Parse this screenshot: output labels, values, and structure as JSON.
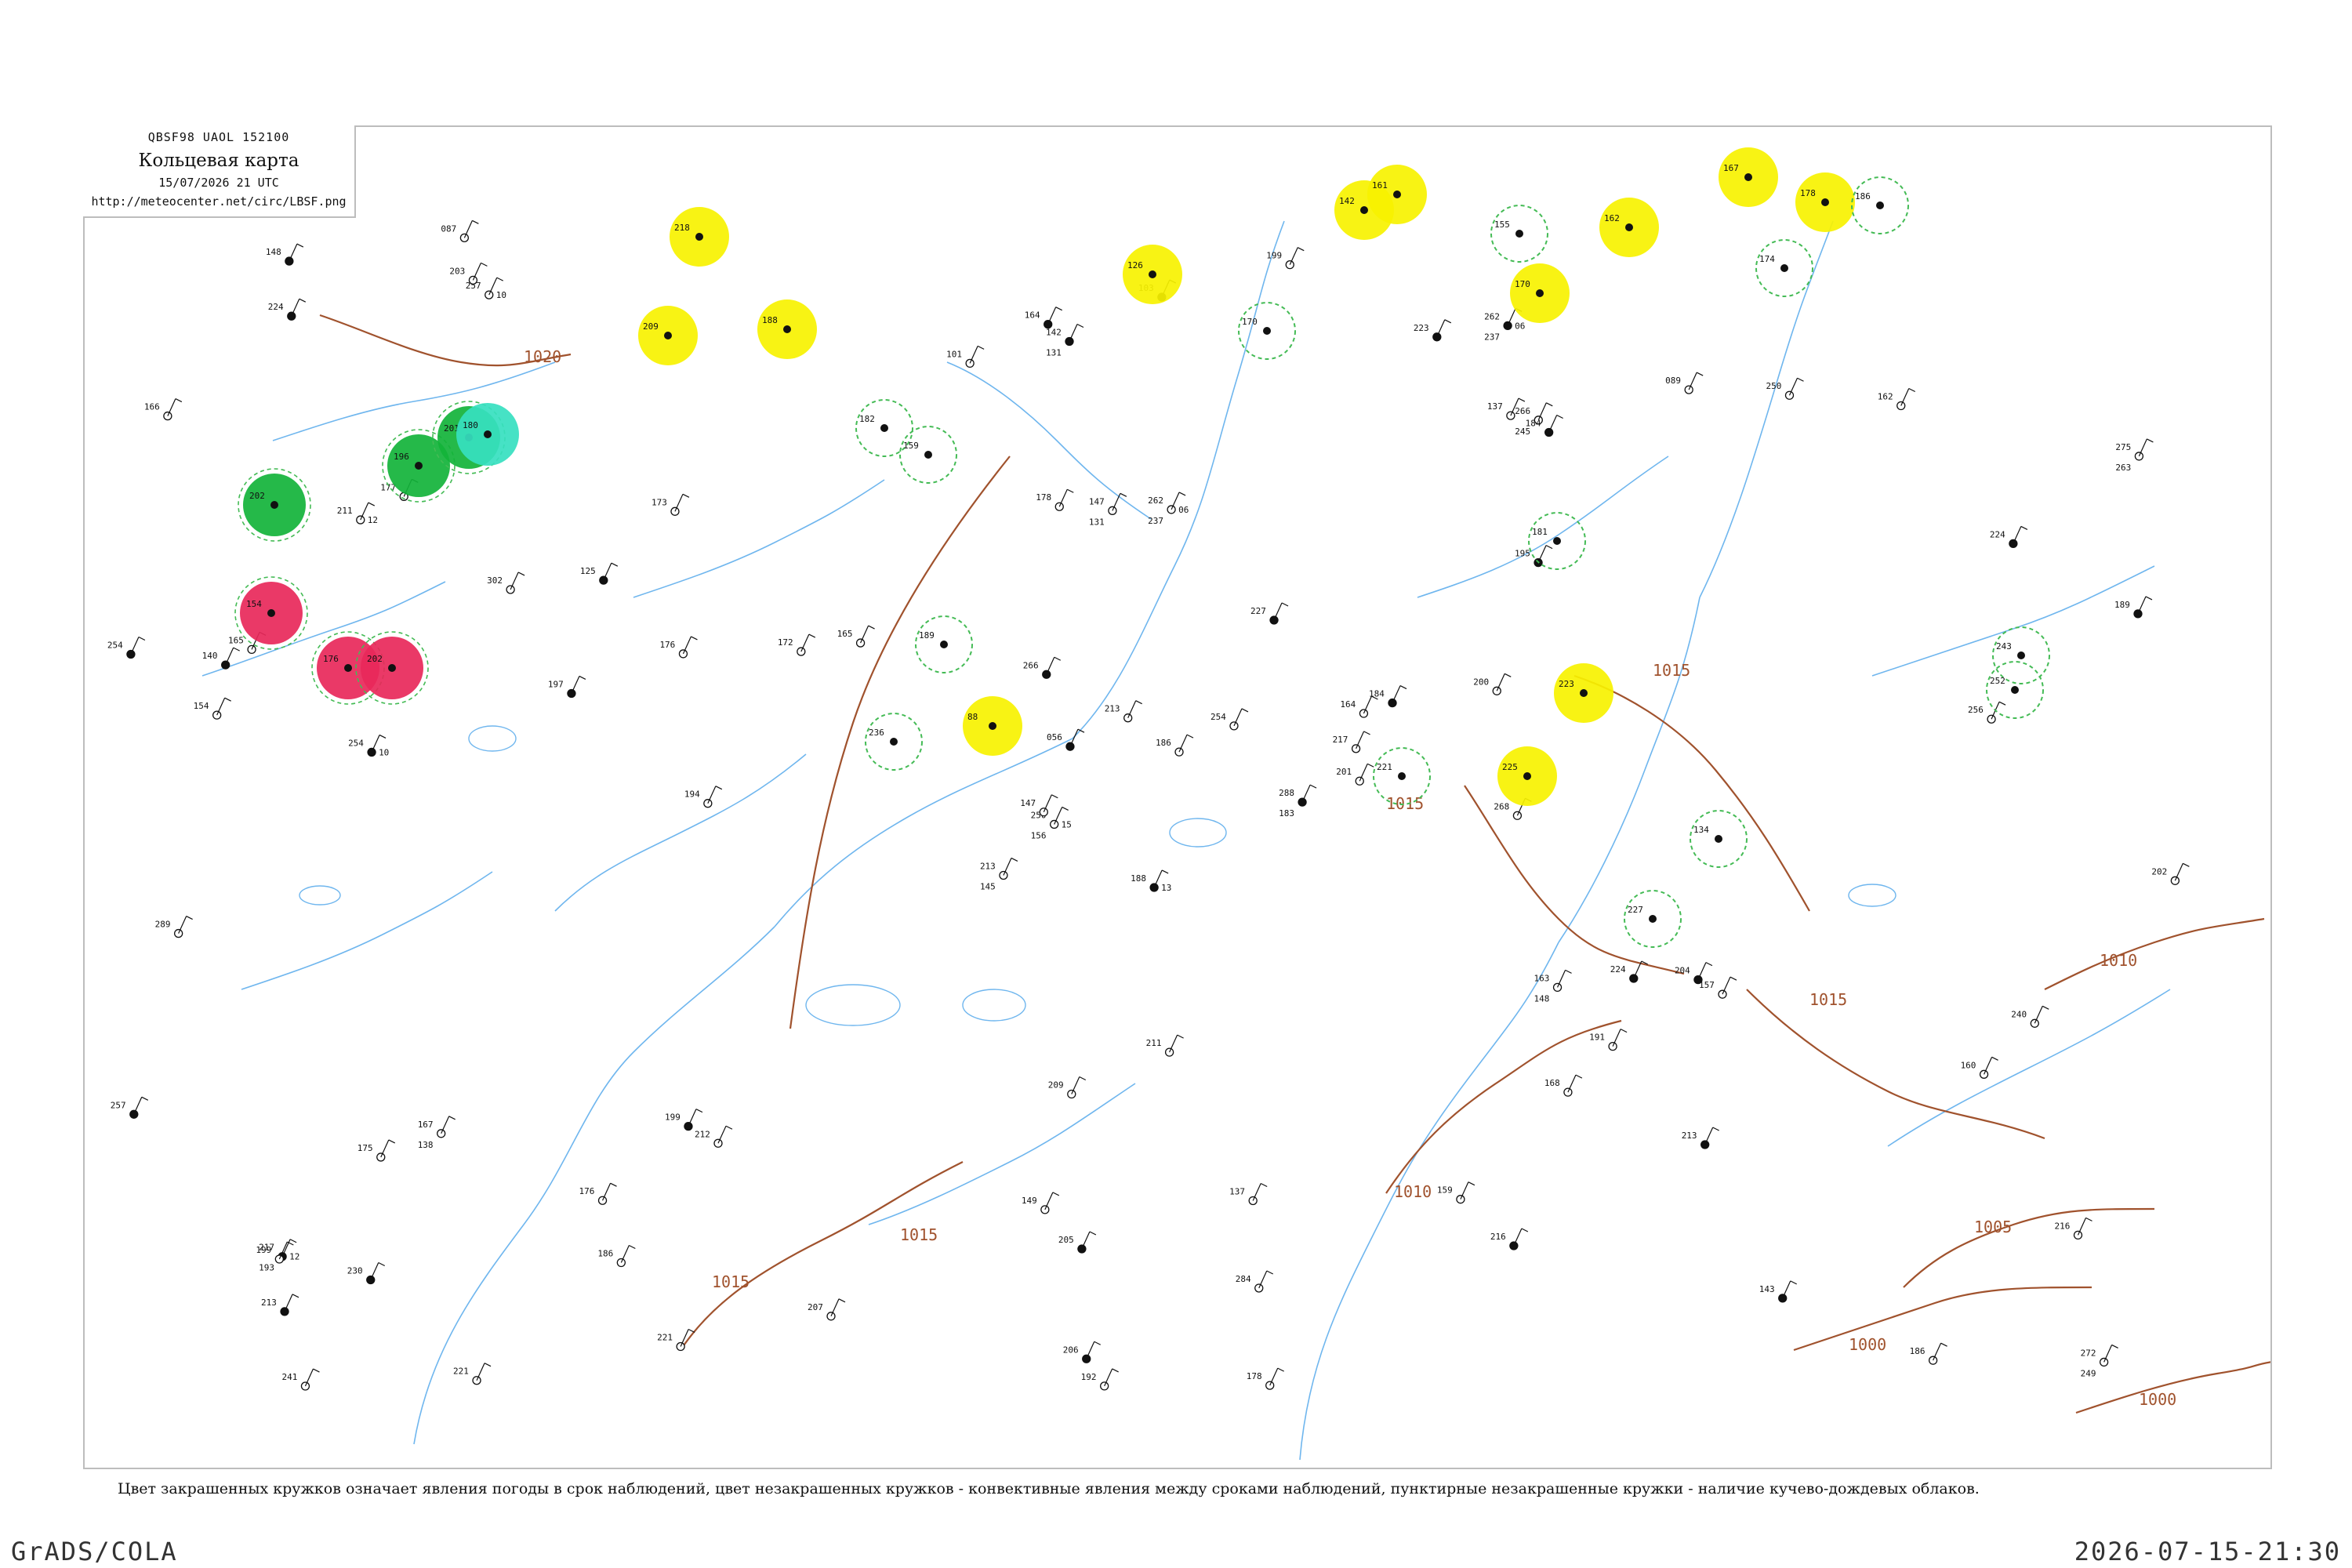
{
  "header": {
    "code_line": "QBSF98  UAOL  152100",
    "title": "Кольцевая карта",
    "datetime": "15/07/2026 21 UTC",
    "url": "http://meteocenter.net/circ/LBSF.png"
  },
  "caption": "Цвет закрашенных кружков означает явления погоды в срок наблюдений, цвет незакрашенных кружков - конвективные явления между сроками наблюдений, пунктирные незакрашенные кружки - наличие кучево-дождевых облаков.",
  "footer": {
    "software": "GrADS/COLA",
    "timestamp": "2026-07-15-21:30"
  },
  "colors": {
    "isobar": "#a0522d",
    "river": "#6fb6ee",
    "frame": "#bdbdbd",
    "thunderstorm": "#e8285a",
    "rain": "#12b33a",
    "showers": "#36e0c0",
    "fog_haze": "#f7f200",
    "cumulonimbus": "#44bb55"
  },
  "isobars": [
    {
      "label": "1020"
    },
    {
      "label": "1015"
    },
    {
      "label": "1015"
    },
    {
      "label": "1015"
    },
    {
      "label": "1015"
    },
    {
      "label": "1015"
    },
    {
      "label": "1010"
    },
    {
      "label": "1010"
    },
    {
      "label": "1005"
    },
    {
      "label": "1000"
    },
    {
      "label": "1000"
    }
  ],
  "stations": [
    {
      "pressure": "188",
      "td": "13",
      "temp": "",
      "id": ""
    },
    {
      "pressure": "211",
      "td": "12",
      "temp": "",
      "id": ""
    },
    {
      "pressure": "250",
      "td": "15",
      "temp": "156",
      "id": ""
    },
    {
      "pressure": "217",
      "td": "12",
      "temp": "193",
      "id": ""
    },
    {
      "pressure": "164",
      "td": "",
      "temp": "",
      "id": ""
    },
    {
      "pressure": "212",
      "td": "",
      "temp": "",
      "id": ""
    },
    {
      "pressure": "262",
      "td": "06",
      "temp": "237",
      "id": ""
    },
    {
      "pressure": "262",
      "td": "06",
      "temp": "237",
      "id": ""
    },
    {
      "pressure": "266",
      "td": "",
      "temp": "245",
      "id": ""
    },
    {
      "pressure": "288",
      "td": "",
      "temp": "183",
      "id": ""
    },
    {
      "pressure": "257",
      "td": "10",
      "temp": "",
      "id": ""
    },
    {
      "pressure": "272",
      "td": "",
      "temp": "249",
      "id": ""
    },
    {
      "pressure": "254",
      "td": "10",
      "temp": "",
      "id": ""
    },
    {
      "pressure": "275",
      "td": "",
      "temp": "263",
      "id": ""
    },
    {
      "pressure": "213",
      "td": "",
      "temp": "145",
      "id": ""
    },
    {
      "pressure": "195",
      "td": "",
      "temp": "",
      "id": ""
    },
    {
      "pressure": "221",
      "td": "",
      "temp": "",
      "id": ""
    },
    {
      "pressure": "178",
      "td": "",
      "temp": "",
      "id": ""
    },
    {
      "pressure": "227",
      "td": "",
      "temp": "",
      "id": ""
    },
    {
      "pressure": "167",
      "td": "",
      "temp": "138",
      "id": ""
    },
    {
      "pressure": "165",
      "td": "",
      "temp": "",
      "id": ""
    },
    {
      "pressure": "213",
      "td": "",
      "temp": "",
      "id": ""
    },
    {
      "pressure": "186",
      "td": "",
      "temp": "",
      "id": ""
    },
    {
      "pressure": "147",
      "td": "",
      "temp": "131",
      "id": ""
    },
    {
      "pressure": "184",
      "td": "",
      "temp": "",
      "id": ""
    },
    {
      "pressure": "157",
      "td": "",
      "temp": "",
      "id": ""
    },
    {
      "pressure": "177",
      "td": "",
      "temp": "",
      "id": ""
    },
    {
      "pressure": "142",
      "td": "",
      "temp": "131",
      "id": ""
    },
    {
      "pressure": "154",
      "td": "",
      "temp": "",
      "id": ""
    },
    {
      "pressure": "163",
      "td": "",
      "temp": "148",
      "id": ""
    },
    {
      "pressure": "189",
      "td": "",
      "temp": "",
      "id": ""
    },
    {
      "pressure": "147",
      "td": "",
      "temp": "",
      "id": ""
    },
    {
      "pressure": "149",
      "td": "",
      "temp": "",
      "id": ""
    },
    {
      "pressure": "056",
      "td": "",
      "temp": "",
      "id": ""
    },
    {
      "pressure": "173",
      "td": "",
      "temp": "",
      "id": ""
    },
    {
      "pressure": "089",
      "td": "",
      "temp": "",
      "id": ""
    },
    {
      "pressure": "199",
      "td": "",
      "temp": "",
      "id": ""
    },
    {
      "pressure": "186",
      "td": "",
      "temp": "",
      "id": ""
    },
    {
      "pressure": "216",
      "td": "",
      "temp": "",
      "id": ""
    },
    {
      "pressure": "204",
      "td": "",
      "temp": "",
      "id": ""
    },
    {
      "pressure": "199",
      "td": "",
      "temp": "",
      "id": ""
    },
    {
      "pressure": "172",
      "td": "",
      "temp": "",
      "id": ""
    },
    {
      "pressure": "197",
      "td": "",
      "temp": "",
      "id": ""
    },
    {
      "pressure": "168",
      "td": "",
      "temp": "",
      "id": ""
    },
    {
      "pressure": "221",
      "td": "",
      "temp": "",
      "id": ""
    },
    {
      "pressure": "254",
      "td": "",
      "temp": "",
      "id": ""
    },
    {
      "pressure": "217",
      "td": "",
      "temp": "",
      "id": ""
    },
    {
      "pressure": "241",
      "td": "",
      "temp": "",
      "id": ""
    },
    {
      "pressure": "205",
      "td": "",
      "temp": "",
      "id": ""
    },
    {
      "pressure": "201",
      "td": "",
      "temp": "",
      "id": ""
    },
    {
      "pressure": "175",
      "td": "",
      "temp": "",
      "id": ""
    },
    {
      "pressure": "224",
      "td": "",
      "temp": "",
      "id": ""
    },
    {
      "pressure": "166",
      "td": "",
      "temp": "",
      "id": ""
    },
    {
      "pressure": "191",
      "td": "",
      "temp": "",
      "id": ""
    },
    {
      "pressure": "216",
      "td": "",
      "temp": "",
      "id": ""
    },
    {
      "pressure": "176",
      "td": "",
      "temp": "",
      "id": ""
    },
    {
      "pressure": "203",
      "td": "",
      "temp": "",
      "id": ""
    },
    {
      "pressure": "148",
      "td": "",
      "temp": "",
      "id": ""
    },
    {
      "pressure": "137",
      "td": "",
      "temp": "",
      "id": ""
    },
    {
      "pressure": "162",
      "td": "",
      "temp": "",
      "id": ""
    },
    {
      "pressure": "103",
      "td": "",
      "temp": "",
      "id": ""
    },
    {
      "pressure": "194",
      "td": "",
      "temp": "",
      "id": ""
    },
    {
      "pressure": "165",
      "td": "",
      "temp": "",
      "id": ""
    },
    {
      "pressure": "125",
      "td": "",
      "temp": "",
      "id": ""
    },
    {
      "pressure": "250",
      "td": "",
      "temp": "",
      "id": ""
    },
    {
      "pressure": "087",
      "td": "",
      "temp": "",
      "id": ""
    },
    {
      "pressure": "223",
      "td": "",
      "temp": "",
      "id": ""
    },
    {
      "pressure": "101",
      "td": "",
      "temp": "",
      "id": ""
    },
    {
      "pressure": "213",
      "td": "",
      "temp": "",
      "id": ""
    },
    {
      "pressure": "257",
      "td": "",
      "temp": "",
      "id": ""
    },
    {
      "pressure": "209",
      "td": "",
      "temp": "",
      "id": ""
    },
    {
      "pressure": "207",
      "td": "",
      "temp": "",
      "id": ""
    },
    {
      "pressure": "224",
      "td": "",
      "temp": "",
      "id": ""
    },
    {
      "pressure": "176",
      "td": "",
      "temp": "",
      "id": ""
    },
    {
      "pressure": "199",
      "td": "",
      "temp": "",
      "id": ""
    },
    {
      "pressure": "224",
      "td": "",
      "temp": "",
      "id": ""
    },
    {
      "pressure": "302",
      "td": "",
      "temp": "",
      "id": ""
    },
    {
      "pressure": "289",
      "td": "",
      "temp": "",
      "id": ""
    },
    {
      "pressure": "266",
      "td": "",
      "temp": "",
      "id": ""
    },
    {
      "pressure": "284",
      "td": "",
      "temp": "",
      "id": ""
    },
    {
      "pressure": "254",
      "td": "",
      "temp": "",
      "id": ""
    },
    {
      "pressure": "230",
      "td": "",
      "temp": "",
      "id": ""
    },
    {
      "pressure": "268",
      "td": "",
      "temp": "",
      "id": ""
    },
    {
      "pressure": "240",
      "td": "",
      "temp": "",
      "id": ""
    },
    {
      "pressure": "206",
      "td": "",
      "temp": "",
      "id": ""
    },
    {
      "pressure": "256",
      "td": "",
      "temp": "",
      "id": ""
    },
    {
      "pressure": "211",
      "td": "",
      "temp": "",
      "id": ""
    },
    {
      "pressure": "143",
      "td": "",
      "temp": "",
      "id": ""
    },
    {
      "pressure": "178",
      "td": "",
      "temp": "",
      "id": ""
    },
    {
      "pressure": "159",
      "td": "",
      "temp": "",
      "id": ""
    },
    {
      "pressure": "164",
      "td": "",
      "temp": "",
      "id": ""
    },
    {
      "pressure": "202",
      "td": "",
      "temp": "",
      "id": ""
    },
    {
      "pressure": "200",
      "td": "",
      "temp": "",
      "id": ""
    },
    {
      "pressure": "213",
      "td": "",
      "temp": "",
      "id": ""
    },
    {
      "pressure": "186",
      "td": "",
      "temp": "",
      "id": ""
    },
    {
      "pressure": "160",
      "td": "",
      "temp": "",
      "id": ""
    },
    {
      "pressure": "140",
      "td": "",
      "temp": "",
      "id": ""
    },
    {
      "pressure": "192",
      "td": "",
      "temp": "",
      "id": ""
    },
    {
      "pressure": "137",
      "td": "",
      "temp": "",
      "id": ""
    },
    {
      "pressure": "184",
      "td": "",
      "temp": "",
      "id": ""
    }
  ],
  "weather_circles": [
    {
      "type": "thunderstorm",
      "label": "154"
    },
    {
      "type": "thunderstorm",
      "label": "176"
    },
    {
      "type": "thunderstorm",
      "label": "202"
    },
    {
      "type": "rain",
      "label": "202"
    },
    {
      "type": "rain",
      "label": "196"
    },
    {
      "type": "rain",
      "label": "201"
    },
    {
      "type": "showers",
      "label": "180"
    },
    {
      "type": "fog_haze",
      "label": "218"
    },
    {
      "type": "fog_haze",
      "label": "209"
    },
    {
      "type": "fog_haze",
      "label": "188"
    },
    {
      "type": "fog_haze",
      "label": "126"
    },
    {
      "type": "fog_haze",
      "label": "142"
    },
    {
      "type": "fog_haze",
      "label": "161"
    },
    {
      "type": "fog_haze",
      "label": "88"
    },
    {
      "type": "fog_haze",
      "label": "225"
    },
    {
      "type": "fog_haze",
      "label": "223"
    },
    {
      "type": "fog_haze",
      "label": "170"
    },
    {
      "type": "fog_haze",
      "label": "162"
    },
    {
      "type": "fog_haze",
      "label": "167"
    },
    {
      "type": "fog_haze",
      "label": "178"
    },
    {
      "type": "cumulonimbus",
      "label": "182"
    },
    {
      "type": "cumulonimbus",
      "label": "159"
    },
    {
      "type": "cumulonimbus",
      "label": "189"
    },
    {
      "type": "cumulonimbus",
      "label": "236"
    },
    {
      "type": "cumulonimbus",
      "label": "155"
    },
    {
      "type": "cumulonimbus",
      "label": "221"
    },
    {
      "type": "cumulonimbus",
      "label": "134"
    },
    {
      "type": "cumulonimbus",
      "label": "227"
    },
    {
      "type": "cumulonimbus",
      "label": "181"
    },
    {
      "type": "cumulonimbus",
      "label": "174"
    },
    {
      "type": "cumulonimbus",
      "label": "243"
    },
    {
      "type": "cumulonimbus",
      "label": "252"
    },
    {
      "type": "cumulonimbus",
      "label": "170"
    },
    {
      "type": "cumulonimbus",
      "label": "186"
    }
  ]
}
